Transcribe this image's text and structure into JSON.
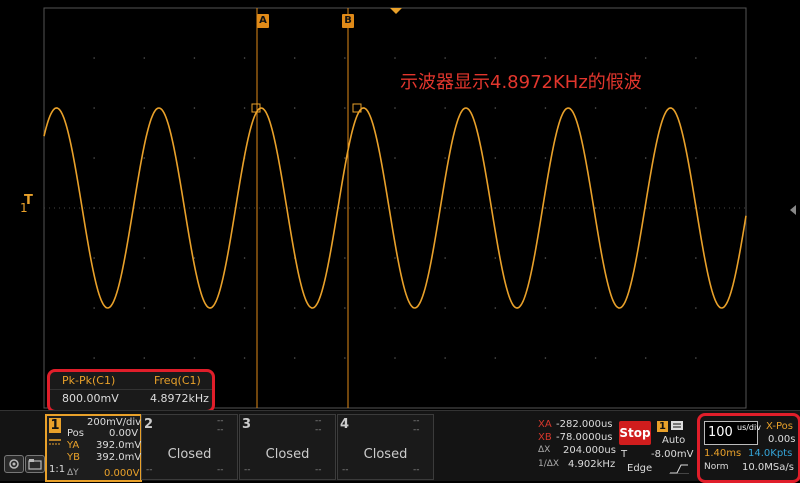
{
  "screen": {
    "cursor_a_label": "A",
    "cursor_b_label": "B",
    "channel_marker": "1",
    "trigger_marker": "T",
    "annotation": "示波器显示4.8972KHz的假波",
    "colors": {
      "trace": "#e9a12a",
      "cursor": "#e08a18",
      "annotation": "#e2362d",
      "highlight": "#e01e2a"
    }
  },
  "measurement": {
    "h1": "Pk-Pk(C1)",
    "h2": "Freq(C1)",
    "v1": "800.00mV",
    "v2": "4.8972kHz"
  },
  "icons": [
    "camera-icon",
    "folder-icon"
  ],
  "ch1": {
    "num": "1",
    "scale": "200mV/div",
    "pos_label": "Pos",
    "pos_value": "0.00V",
    "ya_label": "YA",
    "ya_value": "392.0mV",
    "yb_label": "YB",
    "yb_value": "392.0mV",
    "dy_label": "ΔY",
    "dy_value": "0.000V",
    "coupling": "1:1"
  },
  "ch2": {
    "num": "2",
    "dash": "--",
    "status": "Closed"
  },
  "ch3": {
    "num": "3",
    "dash": "--",
    "status": "Closed"
  },
  "ch4": {
    "num": "4",
    "dash": "--",
    "status": "Closed"
  },
  "cursors": {
    "xa_label": "XA",
    "xa_value": "-282.000us",
    "xb_label": "XB",
    "xb_value": "-78.0000us",
    "dx_label": "ΔX",
    "dx_value": "204.000us",
    "inv_label": "1/ΔX",
    "inv_value": "4.902kHz"
  },
  "trigger": {
    "stop": "Stop",
    "ch": "1",
    "mode": "Auto",
    "t_label": "T",
    "level": "-8.00mV",
    "type": "Edge"
  },
  "timebase": {
    "value": "100",
    "unit": "us/div",
    "xpos_label": "X-Pos",
    "xpos_value": "0.00s",
    "span": "1.40ms",
    "points": "14.0Kpts",
    "acq": "Norm",
    "rate": "10.0MSa/s"
  },
  "wave": {
    "cycles_per_div": 0.49,
    "amplitude_div": 2.0,
    "phase_at_left_div": -0.1
  }
}
